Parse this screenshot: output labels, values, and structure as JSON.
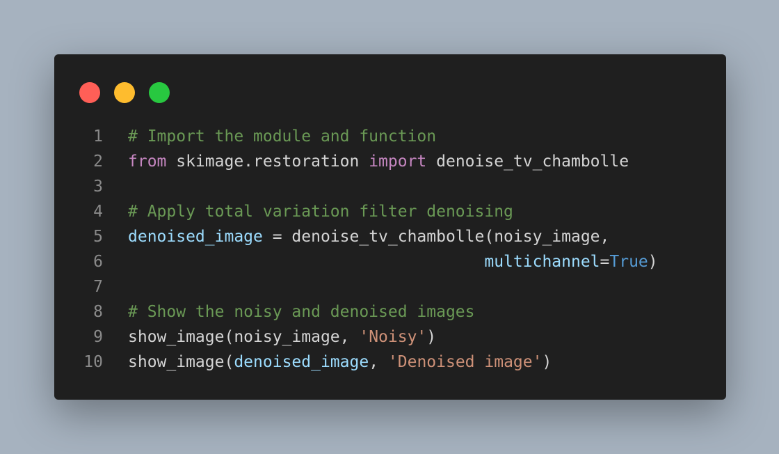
{
  "window": {
    "traffic_lights": [
      {
        "name": "close",
        "color": "#ff5f57"
      },
      {
        "name": "minimize",
        "color": "#febc2e"
      },
      {
        "name": "maximize",
        "color": "#28c840"
      }
    ]
  },
  "code": {
    "lines": [
      {
        "num": "1",
        "tokens": [
          {
            "t": "comment",
            "v": "# Import the module and function"
          }
        ]
      },
      {
        "num": "2",
        "tokens": [
          {
            "t": "keyword",
            "v": "from"
          },
          {
            "t": "plain",
            "v": " skimage.restoration "
          },
          {
            "t": "keyword",
            "v": "import"
          },
          {
            "t": "plain",
            "v": " denoise_tv_chambolle"
          }
        ]
      },
      {
        "num": "3",
        "tokens": []
      },
      {
        "num": "4",
        "tokens": [
          {
            "t": "comment",
            "v": "# Apply total variation filter denoising"
          }
        ]
      },
      {
        "num": "5",
        "tokens": [
          {
            "t": "var",
            "v": "denoised_image"
          },
          {
            "t": "plain",
            "v": " = denoise_tv_chambolle(noisy_image,"
          }
        ]
      },
      {
        "num": "6",
        "tokens": [
          {
            "t": "plain",
            "v": "                                     "
          },
          {
            "t": "param",
            "v": "multichannel"
          },
          {
            "t": "plain",
            "v": "="
          },
          {
            "t": "const",
            "v": "True"
          },
          {
            "t": "plain",
            "v": ")"
          }
        ]
      },
      {
        "num": "7",
        "tokens": []
      },
      {
        "num": "8",
        "tokens": [
          {
            "t": "comment",
            "v": "# Show the noisy and denoised images"
          }
        ]
      },
      {
        "num": "9",
        "tokens": [
          {
            "t": "plain",
            "v": "show_image(noisy_image, "
          },
          {
            "t": "string",
            "v": "'Noisy'"
          },
          {
            "t": "plain",
            "v": ")"
          }
        ]
      },
      {
        "num": "10",
        "tokens": [
          {
            "t": "plain",
            "v": "show_image("
          },
          {
            "t": "var",
            "v": "denoised_image"
          },
          {
            "t": "plain",
            "v": ", "
          },
          {
            "t": "string",
            "v": "'Denoised image'"
          },
          {
            "t": "plain",
            "v": ")"
          }
        ]
      }
    ]
  }
}
